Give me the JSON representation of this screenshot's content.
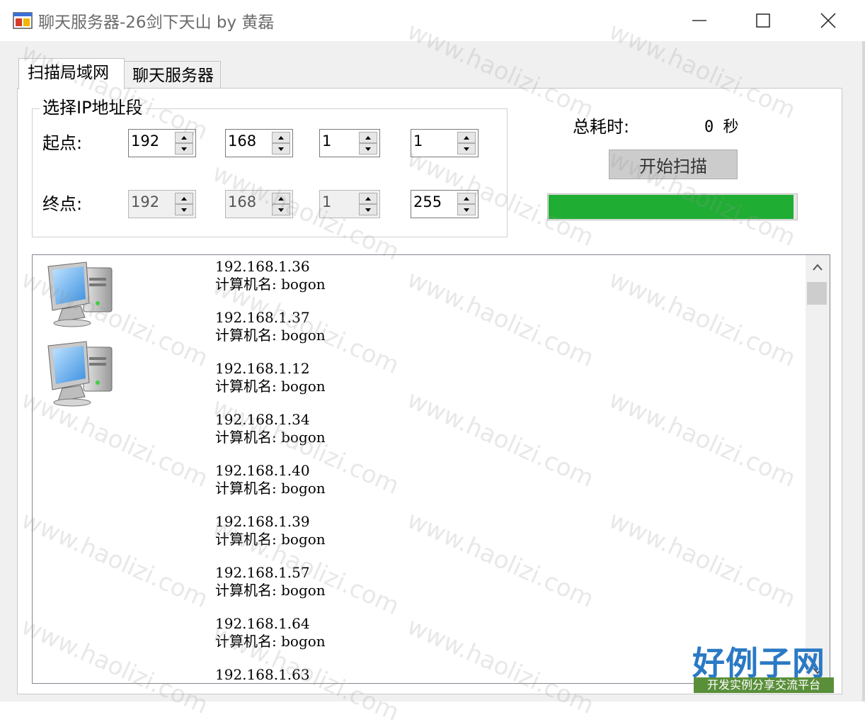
{
  "window": {
    "title": "聊天服务器-26剑下天山 by 黄磊"
  },
  "tabs": [
    {
      "label": "扫描局域网",
      "active": true
    },
    {
      "label": "聊天服务器",
      "active": false
    }
  ],
  "ip_range": {
    "group_title": "选择IP地址段",
    "start_label": "起点:",
    "end_label": "终点:",
    "start": [
      "192",
      "168",
      "1",
      "1"
    ],
    "end": [
      "192",
      "168",
      "1",
      "255"
    ]
  },
  "scan": {
    "elapsed_label": "总耗时:",
    "elapsed_value": "0 秒",
    "button_label": "开始扫描",
    "progress_percent": 100,
    "progress_color": "#1fad33"
  },
  "hosts": [
    {
      "ip": "192.168.1.36",
      "name_label": "计算机名:",
      "name": "bogon"
    },
    {
      "ip": "192.168.1.37",
      "name_label": "计算机名:",
      "name": "bogon"
    },
    {
      "ip": "192.168.1.12",
      "name_label": "计算机名:",
      "name": "bogon"
    },
    {
      "ip": "192.168.1.34",
      "name_label": "计算机名:",
      "name": "bogon"
    },
    {
      "ip": "192.168.1.40",
      "name_label": "计算机名:",
      "name": "bogon"
    },
    {
      "ip": "192.168.1.39",
      "name_label": "计算机名:",
      "name": "bogon"
    },
    {
      "ip": "192.168.1.57",
      "name_label": "计算机名:",
      "name": "bogon"
    },
    {
      "ip": "192.168.1.64",
      "name_label": "计算机名:",
      "name": "bogon"
    },
    {
      "ip": "192.168.1.63"
    }
  ],
  "icons": {
    "app": "app-window-icon",
    "host": "computer-icon",
    "minimize": "minimize-icon",
    "maximize": "maximize-icon",
    "close": "close-icon"
  },
  "watermark": {
    "text": "www.haolizi.com",
    "logo_main": "好例子网",
    "logo_sub": "开发实例分享交流平台"
  }
}
